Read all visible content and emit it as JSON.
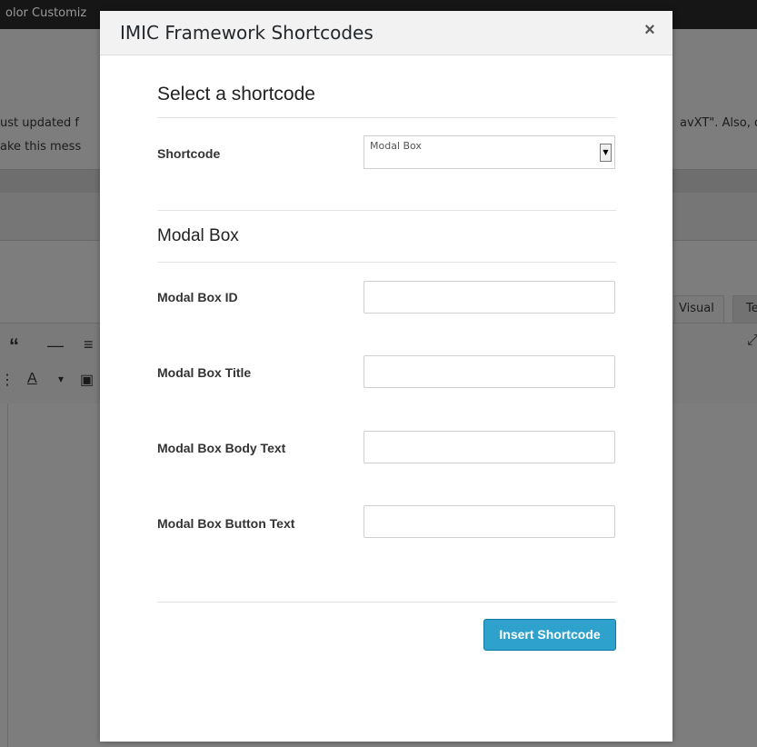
{
  "background": {
    "topbar_text": "olor Customiz",
    "notice_line1": "ust updated f",
    "notice_line2": "ake this mess",
    "notice_right": "avXT\". Also, d",
    "tab_visual": "Visual",
    "tab_text": "Te",
    "toolbar_quote": "“",
    "toolbar_hr": "—",
    "toolbar_align": "≡",
    "toolbar_textcolor": "A",
    "toolbar_dropdown": "▾",
    "toolbar_paste": "▣"
  },
  "modal": {
    "title": "IMIC Framework Shortcodes",
    "close_label": "×",
    "select_heading": "Select a shortcode",
    "shortcode_label": "Shortcode",
    "shortcode_value": "Modal Box",
    "shortcode_arrow": "▼",
    "section_heading": "Modal Box",
    "fields": [
      {
        "label": "Modal Box ID",
        "value": ""
      },
      {
        "label": "Modal Box Title",
        "value": ""
      },
      {
        "label": "Modal Box Body Text",
        "value": ""
      },
      {
        "label": "Modal Box Button Text",
        "value": ""
      }
    ],
    "insert_button": "Insert Shortcode"
  },
  "colors": {
    "overlay": "#7d7d7d",
    "accent": "#2ea2cc",
    "header_bg": "#f2f2f2"
  }
}
